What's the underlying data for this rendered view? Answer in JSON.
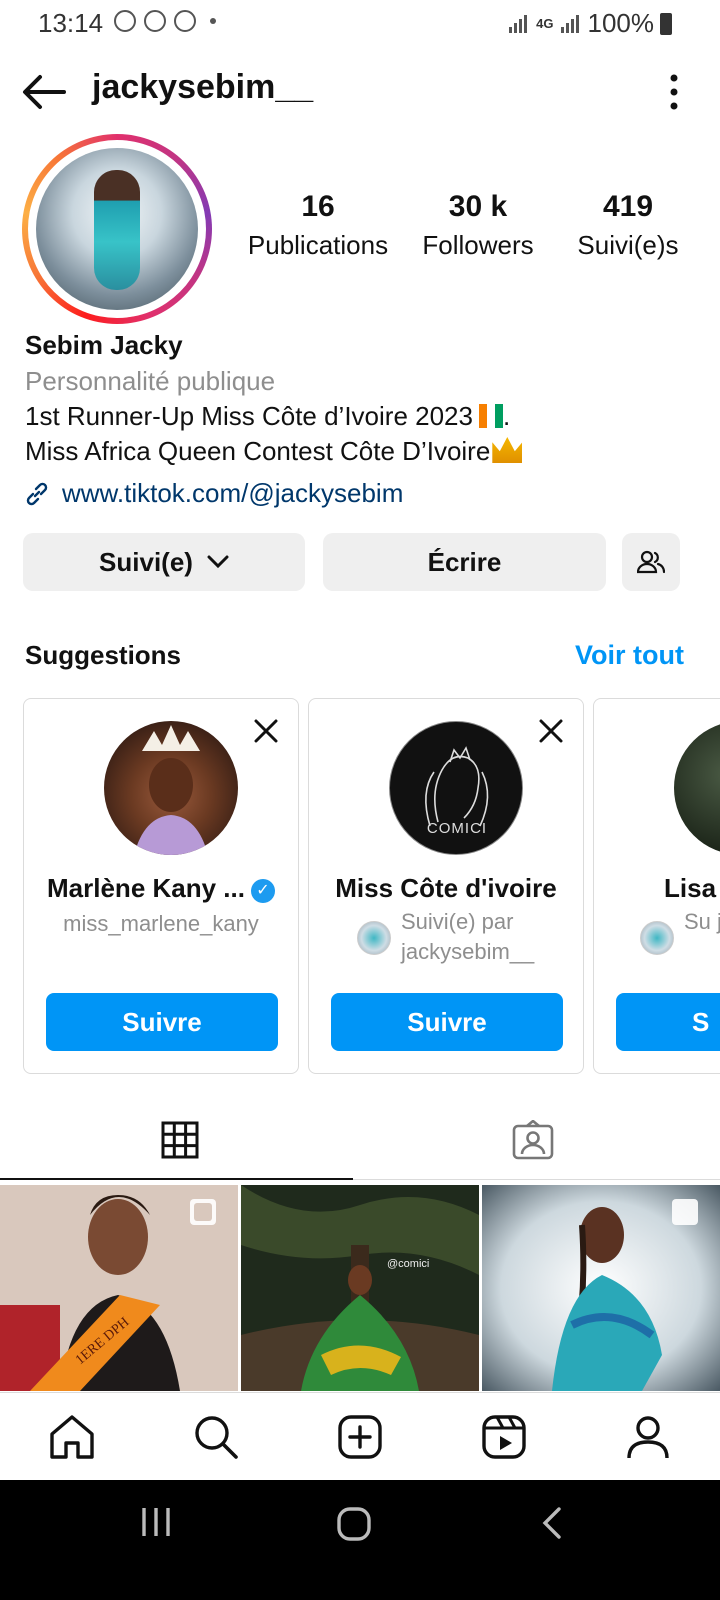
{
  "status_bar": {
    "time": "13:14",
    "network": "4G",
    "battery": "100%"
  },
  "header": {
    "username": "jackysebim__"
  },
  "profile": {
    "stats": [
      {
        "value": "16",
        "label": "Publications"
      },
      {
        "value": "30 k",
        "label": "Followers"
      },
      {
        "value": "419",
        "label": "Suivi(e)s"
      }
    ],
    "name": "Sebim Jacky",
    "category": "Personnalité publique",
    "bio_line1": "1st Runner-Up Miss Côte d’Ivoire 2023",
    "bio_line2": "Miss Africa Queen Contest Côte D’Ivoire",
    "link": "www.tiktok.com/@jackysebim"
  },
  "actions": {
    "following": "Suivi(e)",
    "message": "Écrire"
  },
  "suggestions": {
    "title": "Suggestions",
    "see_all": "Voir tout",
    "cards": [
      {
        "name": "Marlène Kany ...",
        "sub": "miss_marlene_kany",
        "button": "Suivre"
      },
      {
        "name": "Miss Côte d'ivoire",
        "followed_by": "Suivi(e) par jackysebim__",
        "logo_text": "COMICI",
        "button": "Suivre"
      },
      {
        "name": "Lisa",
        "followed_by": "Su jac",
        "button": "S"
      }
    ]
  },
  "posts": [
    {
      "sash_text": "1ERE DPH"
    },
    {
      "watermark": "@comici"
    },
    {
      "watermark": ""
    }
  ],
  "colors": {
    "accent": "#0095f6",
    "link": "#00376b",
    "secondary_text": "#8e8e8e"
  }
}
